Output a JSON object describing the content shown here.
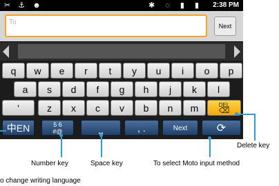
{
  "status": {
    "time": "2:38 PM",
    "left_icons": [
      "missed-call-icon",
      "usb-icon",
      "android-icon"
    ],
    "right_icons": [
      "bluetooth-icon",
      "sync-icon",
      "vibrate-icon",
      "signal-icon",
      "battery-icon"
    ]
  },
  "compose": {
    "to_placeholder": "To",
    "next_label": "Next"
  },
  "keyboard": {
    "row1": [
      "q",
      "w",
      "e",
      "r",
      "t",
      "y",
      "u",
      "i",
      "o",
      "p"
    ],
    "row2": [
      "a",
      "s",
      "d",
      "f",
      "g",
      "h",
      "j",
      "k",
      "l"
    ],
    "row3": [
      "'",
      "z",
      "x",
      "c",
      "v",
      "b",
      "n",
      "m"
    ],
    "del_label": "DEL",
    "lang_label": "中EN",
    "number_label": "5 6\n#@",
    "punct_label": ", .",
    "next_label": "Next"
  },
  "annotations": {
    "delete_key": "Delete key",
    "number_key": "Number key",
    "space_key": "Space key",
    "moto_input": "To select Moto input method",
    "language": "o change writing language"
  },
  "colors": {
    "accent": "#2f9ad6",
    "focus": "#f6a423",
    "key_dark": "#2d5283",
    "del_key": "#f4a800"
  }
}
